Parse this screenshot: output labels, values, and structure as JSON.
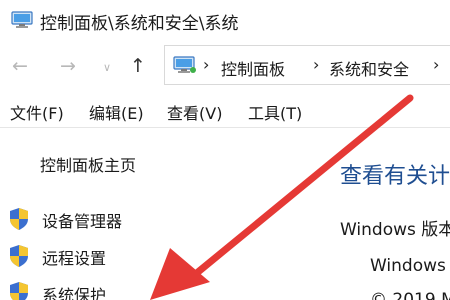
{
  "window": {
    "title": "控制面板\\系统和安全\\系统"
  },
  "address_bar": {
    "icon": "control-panel-icon",
    "crumbs": [
      "控制面板",
      "系统和安全"
    ]
  },
  "menubar": {
    "items": [
      "文件(F)",
      "编辑(E)",
      "查看(V)",
      "工具(T)"
    ]
  },
  "sidebar": {
    "home_label": "控制面板主页",
    "links": [
      {
        "label": "设备管理器",
        "icon": "shield-icon"
      },
      {
        "label": "远程设置",
        "icon": "shield-icon"
      },
      {
        "label": "系统保护",
        "icon": "shield-icon"
      }
    ]
  },
  "main": {
    "heading": "查看有关计",
    "edition_label": "Windows 版本",
    "edition_value": "Windows",
    "copyright": "© 2019 M"
  },
  "annotation": {
    "arrow_color": "#e53935"
  }
}
